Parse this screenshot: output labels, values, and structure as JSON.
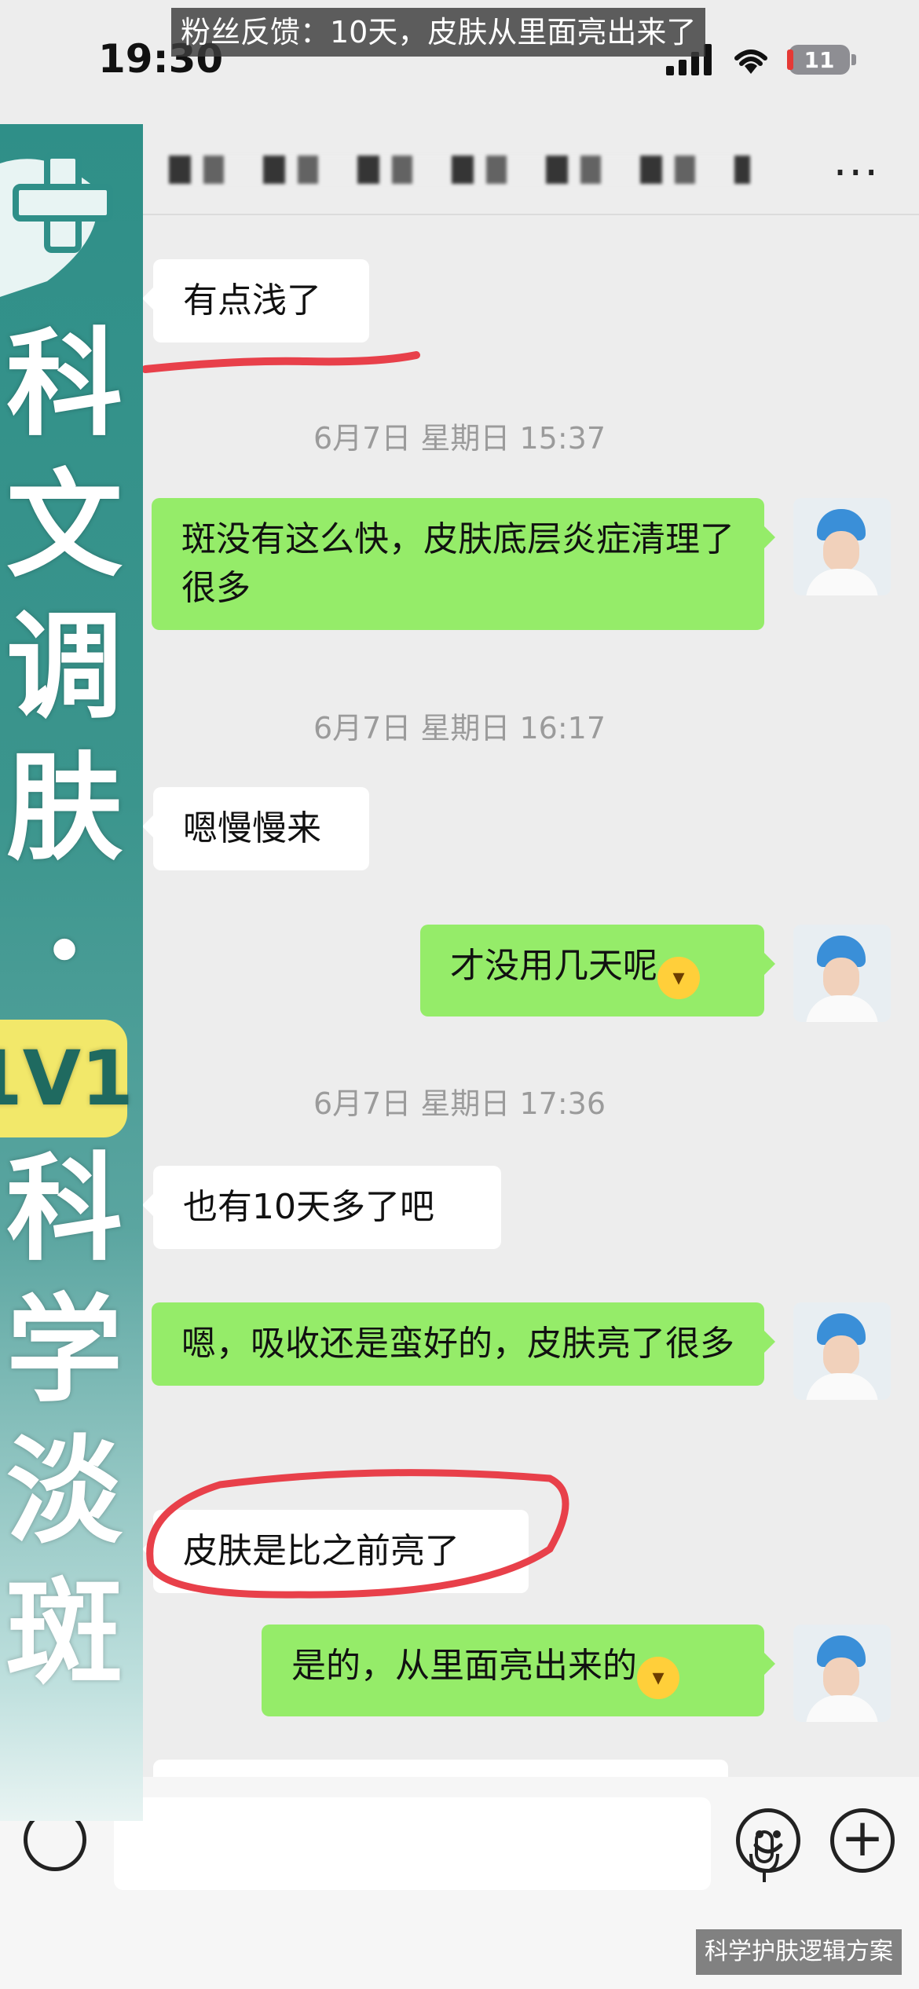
{
  "status_bar": {
    "time": "19:30",
    "battery": "11"
  },
  "banner": {
    "text": "粉丝反馈：10天，皮肤从里面亮出来了"
  },
  "header": {
    "more_label": "···"
  },
  "messages": [
    {
      "side": "left",
      "text": "有点浅了",
      "annotated": true
    },
    {
      "type": "timestamp",
      "text": "6月7日 星期日 15:37"
    },
    {
      "side": "right",
      "text": "斑没有这么快，皮肤底层炎症清理了很多"
    },
    {
      "type": "timestamp",
      "text": "6月7日 星期日 16:17"
    },
    {
      "side": "left",
      "text": "嗯慢慢来"
    },
    {
      "side": "right",
      "text": "才没用几天呢",
      "emoji": "grin-emoji"
    },
    {
      "type": "timestamp",
      "text": "6月7日 星期日 17:36"
    },
    {
      "side": "left",
      "text": "也有10天多了吧"
    },
    {
      "side": "right",
      "text": "嗯，吸收还是蛮好的，皮肤亮了很多"
    },
    {
      "side": "left",
      "text": "皮肤是比之前亮了",
      "annotated": true
    },
    {
      "side": "right",
      "text": "是的，从里面亮出来的",
      "emoji": "grin-emoji"
    }
  ],
  "side_panel": {
    "chars": [
      "科",
      "文",
      "调",
      "肤",
      "·"
    ],
    "badge": "1V1",
    "chars2": [
      "科",
      "学",
      "淡",
      "斑"
    ]
  },
  "watermark": {
    "text": "科学护肤逻辑方案"
  },
  "colors": {
    "right_bubble": "#95ec69",
    "left_bubble": "#ffffff",
    "annotation": "#e8404a",
    "panel": "#2f8f88"
  },
  "icons": [
    "signal-icon",
    "wifi-icon",
    "battery-icon",
    "more-icon",
    "mic-icon",
    "emoji-icon",
    "plus-icon"
  ]
}
